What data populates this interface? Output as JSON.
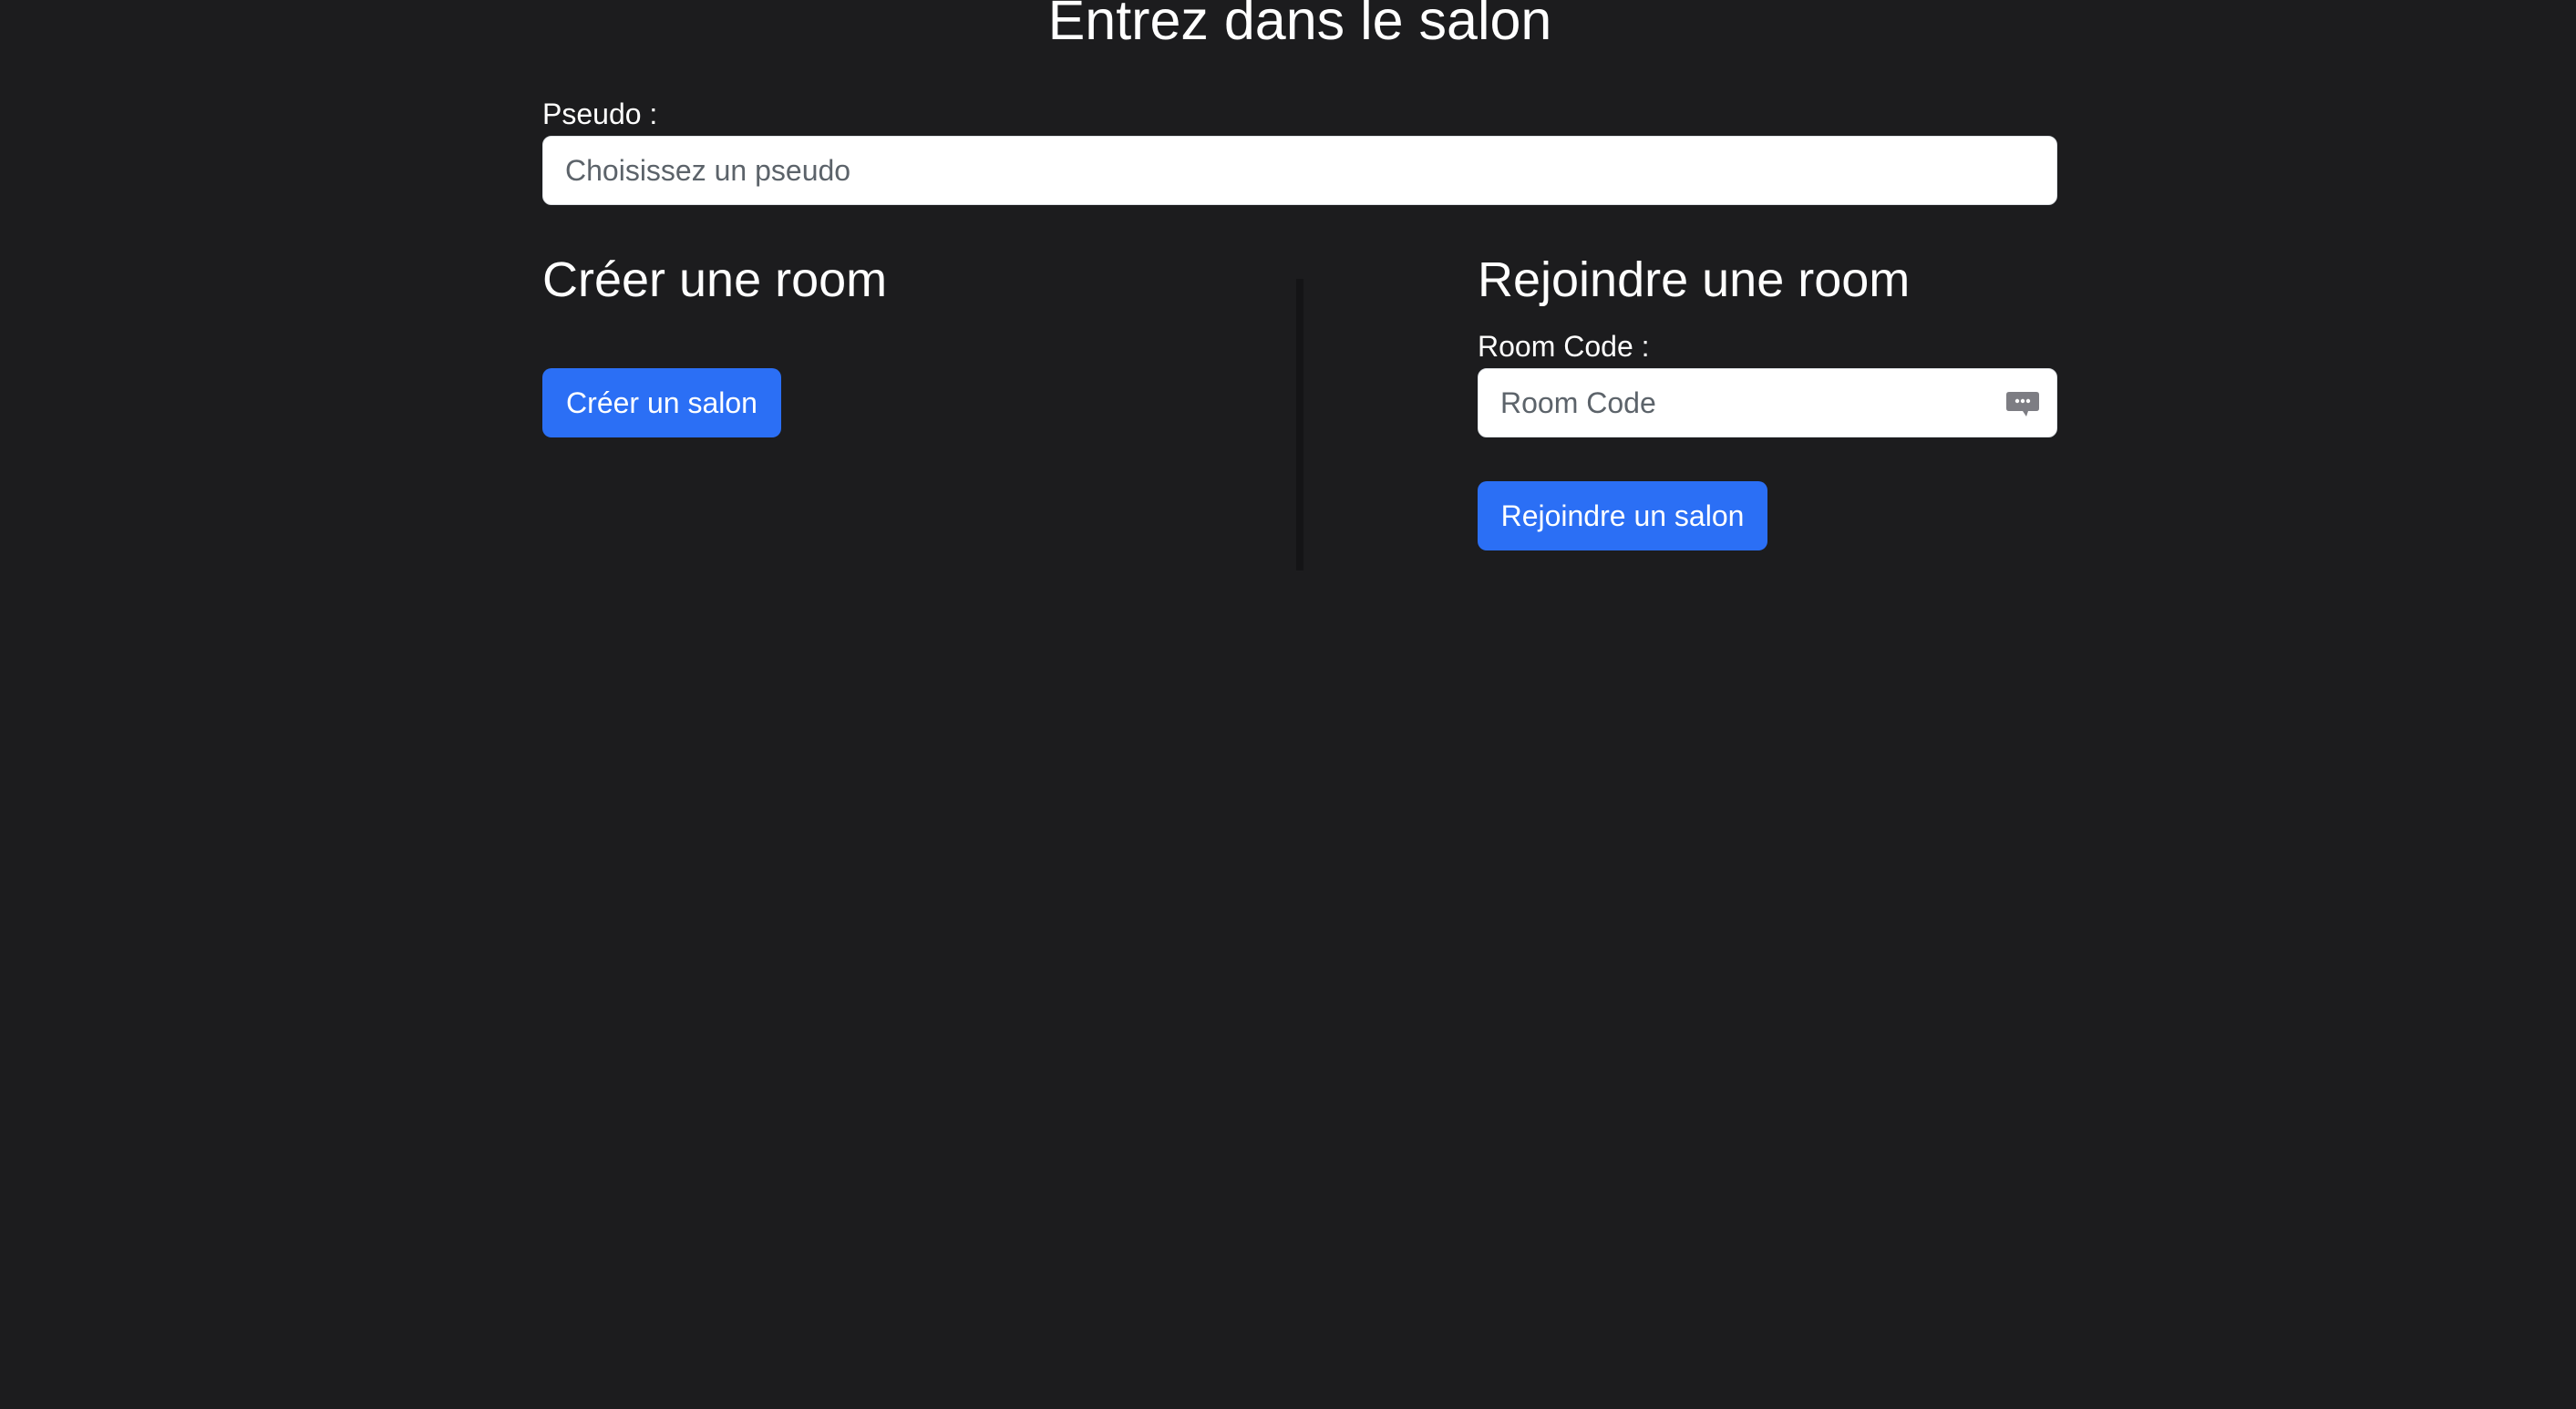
{
  "page": {
    "title": "Entrez dans le salon"
  },
  "pseudo": {
    "label": "Pseudo :",
    "placeholder": "Choisissez un pseudo",
    "value": ""
  },
  "create": {
    "heading": "Créer une room",
    "button_label": "Créer un salon"
  },
  "join": {
    "heading": "Rejoindre une room",
    "code_label": "Room Code :",
    "code_placeholder": "Room Code",
    "code_value": "",
    "code_icon": "chat-bubble-icon",
    "button_label": "Rejoindre un salon"
  },
  "colors": {
    "background": "#1c1c1e",
    "accent": "#2b6ff5",
    "text": "#ffffff"
  }
}
